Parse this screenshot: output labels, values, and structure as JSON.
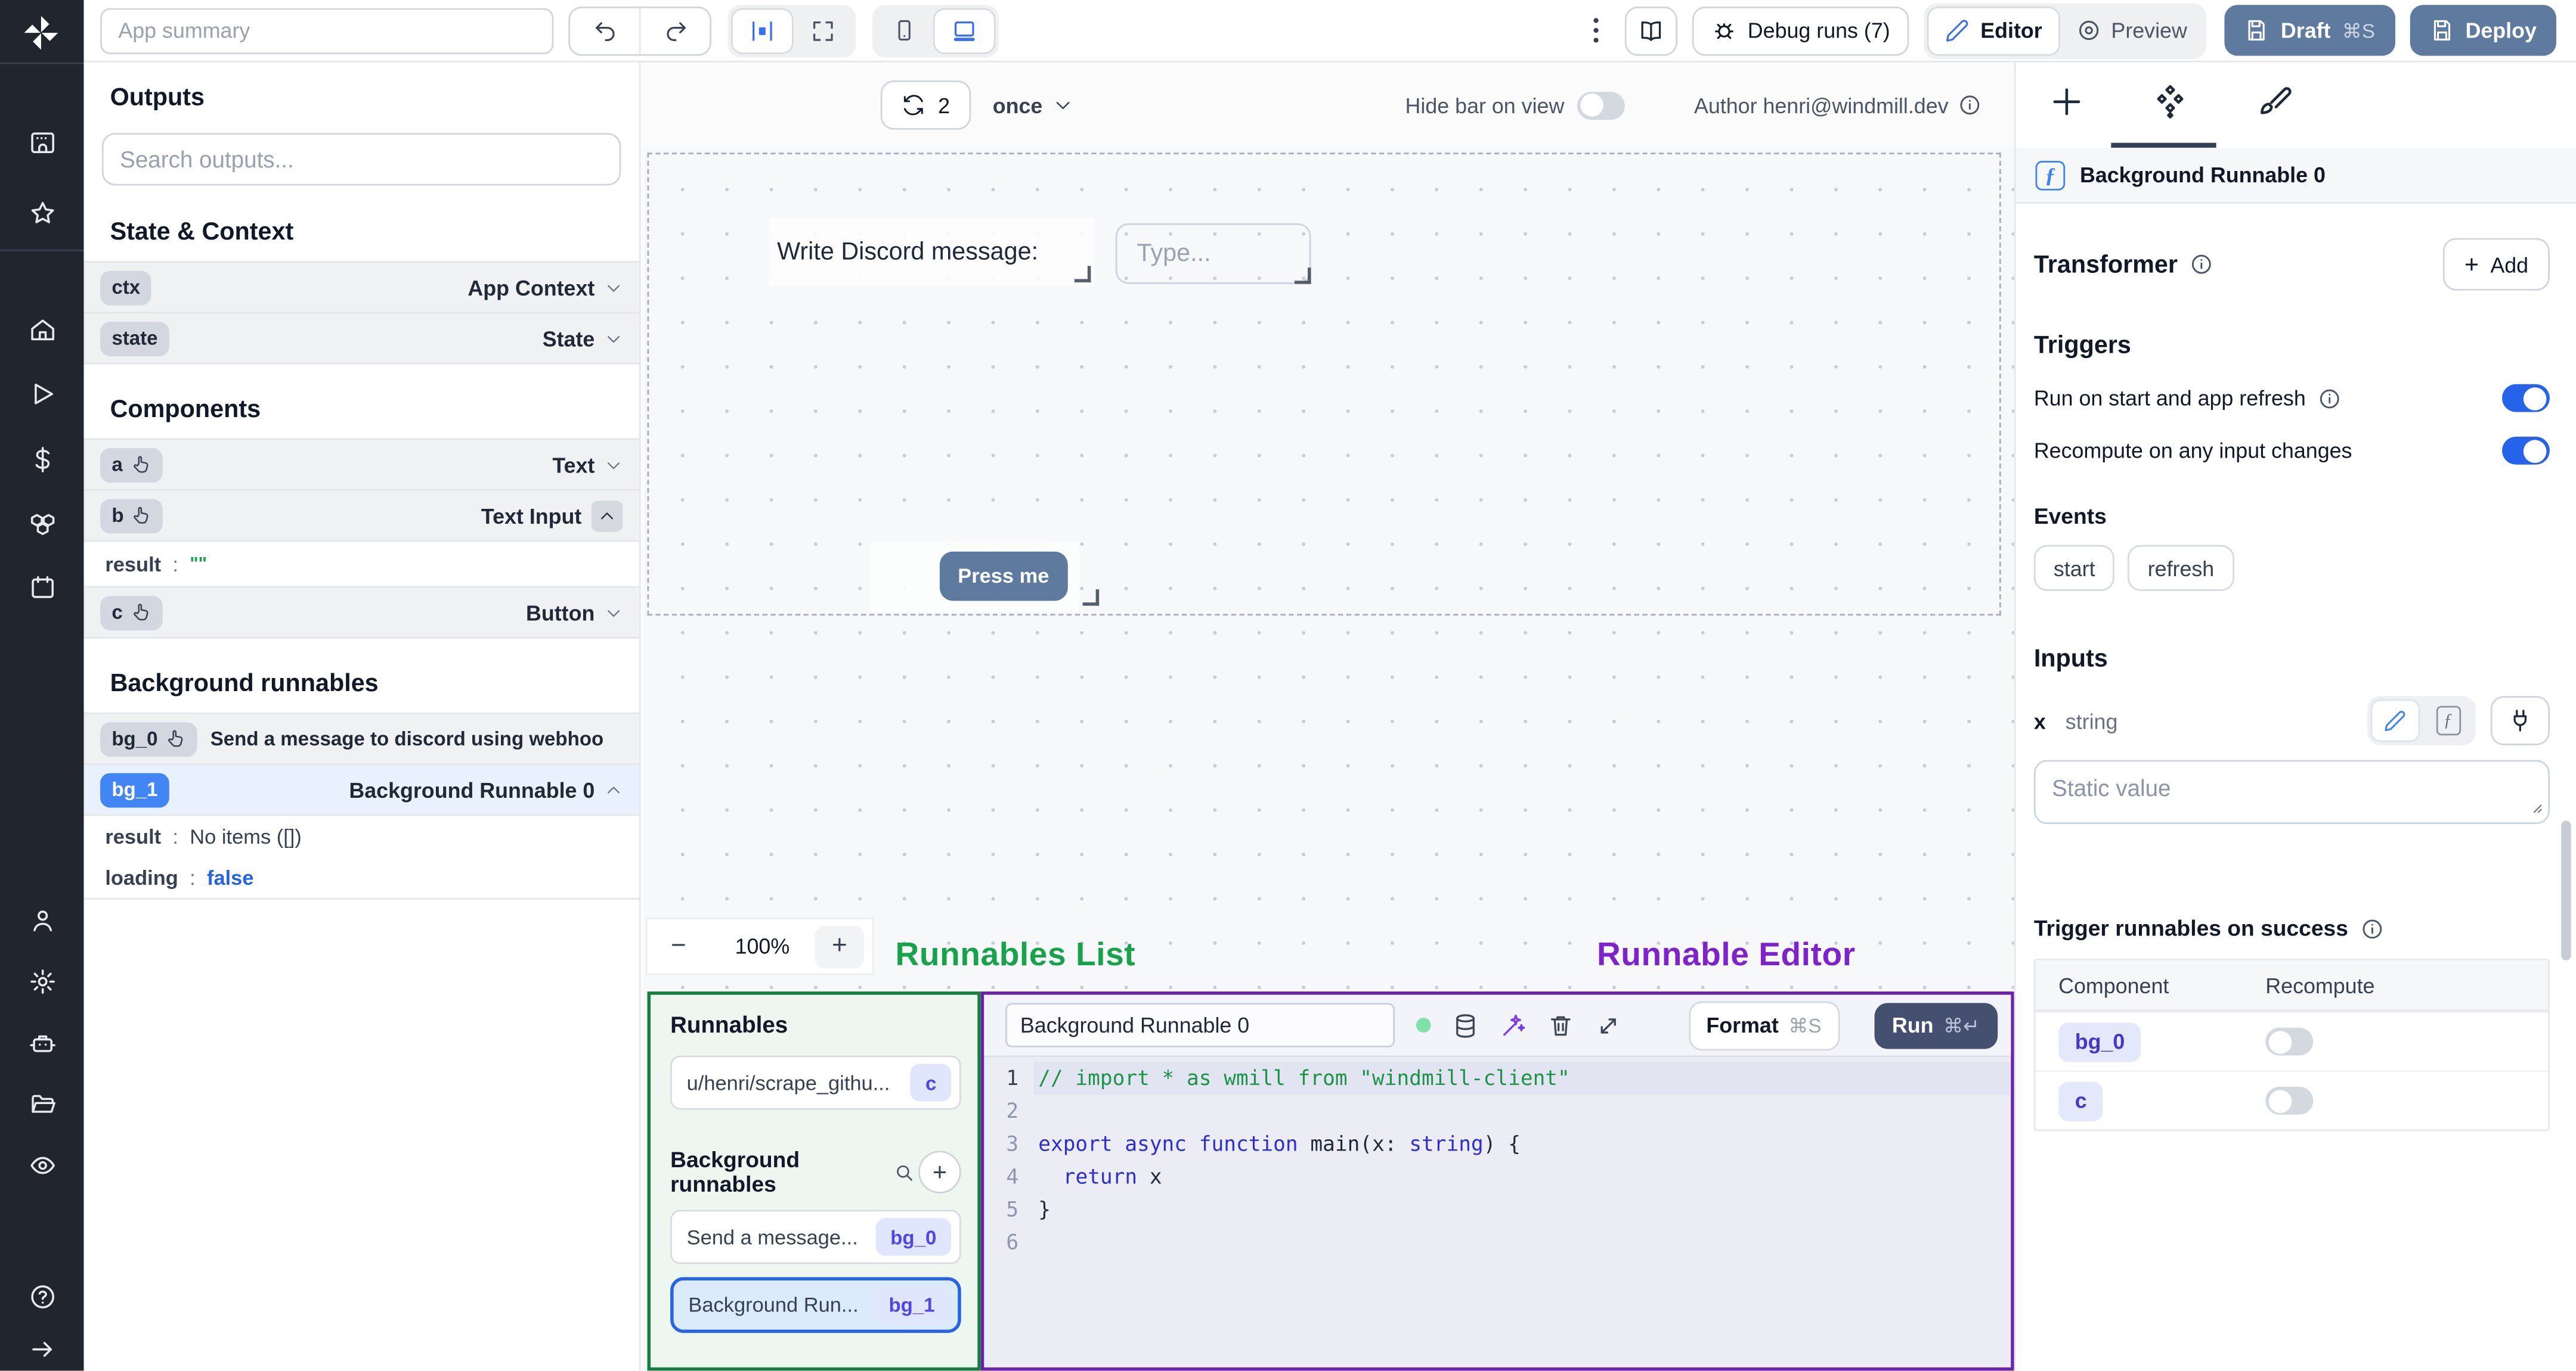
{
  "topbar": {
    "app_summary_placeholder": "App summary",
    "debug_runs": "Debug runs (7)",
    "editor": "Editor",
    "preview": "Preview",
    "draft": "Draft",
    "draft_shortcut": "⌘S",
    "deploy": "Deploy"
  },
  "canvas_toolbar": {
    "refresh_count": "2",
    "frequency": "once",
    "hide_bar": "Hide bar on view",
    "author": "Author henri@windmill.dev"
  },
  "outputs": {
    "title": "Outputs",
    "search_placeholder": "Search outputs...",
    "state_context_heading": "State & Context",
    "ctx_id": "ctx",
    "ctx_type": "App Context",
    "state_id": "state",
    "state_type": "State",
    "components_heading": "Components",
    "a_id": "a",
    "a_type": "Text",
    "b_id": "b",
    "b_type": "Text Input",
    "b_result_key": "result",
    "b_result_value": "\"\"",
    "c_id": "c",
    "c_type": "Button",
    "bg_heading": "Background runnables",
    "bg0_id": "bg_0",
    "bg0_label": "Send a message to discord using webhoo",
    "bg1_id": "bg_1",
    "bg1_label": "Background Runnable 0",
    "bg1_result_key": "result",
    "bg1_result_value": "No items ([])",
    "bg1_loading_key": "loading",
    "bg1_loading_value": "false"
  },
  "canvas": {
    "discord_label": "Write Discord message:",
    "type_placeholder": "Type...",
    "press_me": "Press me",
    "zoom_out": "−",
    "zoom_level": "100%",
    "zoom_in": "+"
  },
  "annotations": {
    "runnables_list": "Runnables List",
    "runnable_editor": "Runnable Editor",
    "green": "#16a34a",
    "purple": "#7e22ce"
  },
  "runnables": {
    "title": "Runnables",
    "script_label": "u/henri/scrape_githu...",
    "script_badge": "c",
    "bg_heading": "Background runnables",
    "bg0_label": "Send a message...",
    "bg0_badge": "bg_0",
    "bg1_label": "Background Run...",
    "bg1_badge": "bg_1"
  },
  "editor": {
    "name": "Background Runnable 0",
    "format": "Format",
    "format_shortcut": "⌘S",
    "run": "Run",
    "run_shortcut": "⌘↵",
    "code_lines": [
      [
        [
          "// import * as wmill from \"windmill-client\"",
          "c"
        ]
      ],
      [],
      [
        [
          "export async function ",
          "k"
        ],
        [
          "main",
          "p"
        ],
        [
          "(x: ",
          "p"
        ],
        [
          "string",
          "k"
        ],
        [
          ") {",
          "p"
        ]
      ],
      [
        [
          "  ",
          "p"
        ],
        [
          "return",
          "k"
        ],
        [
          " x",
          "p"
        ]
      ],
      [
        [
          "}",
          "p"
        ]
      ],
      []
    ]
  },
  "panel": {
    "header": "Background Runnable 0",
    "transformer": "Transformer",
    "add_plus": "+",
    "add": "Add",
    "triggers": "Triggers",
    "trigger_run": "Run on start and app refresh",
    "trigger_recompute": "Recompute on any input changes",
    "events": "Events",
    "chips": [
      "start",
      "refresh"
    ],
    "inputs": "Inputs",
    "input_name": "x",
    "input_type": "string",
    "static_placeholder": "Static value",
    "success_heading": "Trigger runnables on success",
    "col_component": "Component",
    "col_recompute": "Recompute",
    "rows": [
      {
        "badge": "bg_0"
      },
      {
        "badge": "c"
      }
    ]
  }
}
